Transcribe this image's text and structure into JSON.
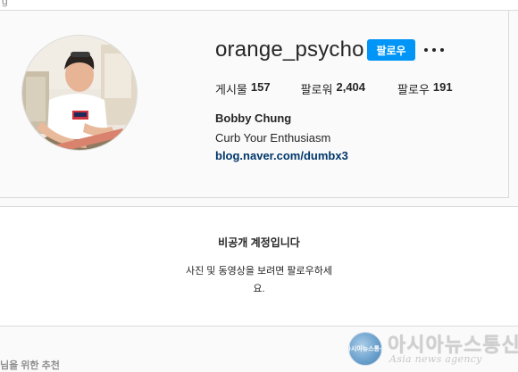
{
  "top_strip": {
    "glyph": "g"
  },
  "profile": {
    "username": "orange_psycho",
    "follow_label": "팔로우",
    "more_icon": "more-horizontal-icon",
    "stats": [
      {
        "label": "게시물",
        "value": "157"
      },
      {
        "label": "팔로워",
        "value": "2,404"
      },
      {
        "label": "팔로우",
        "value": "191"
      }
    ],
    "full_name": "Bobby Chung",
    "bio": "Curb Your Enthusiasm",
    "link": "blog.naver.com/dumbx3"
  },
  "private_notice": {
    "title": "비공개 계정입니다",
    "description_line1": "사진 및 동영상을 보려면 팔로우하세",
    "description_line2": "요."
  },
  "suggestions": {
    "label": "님을 위한 추천"
  },
  "watermark": {
    "logo_text": "아시아뉴스통신",
    "name": "아시아뉴스통신",
    "sub": "Asia news agency"
  },
  "colors": {
    "accent": "#0095f6",
    "link": "#00376b",
    "border": "#dbdbdb",
    "background": "#fafafa"
  }
}
